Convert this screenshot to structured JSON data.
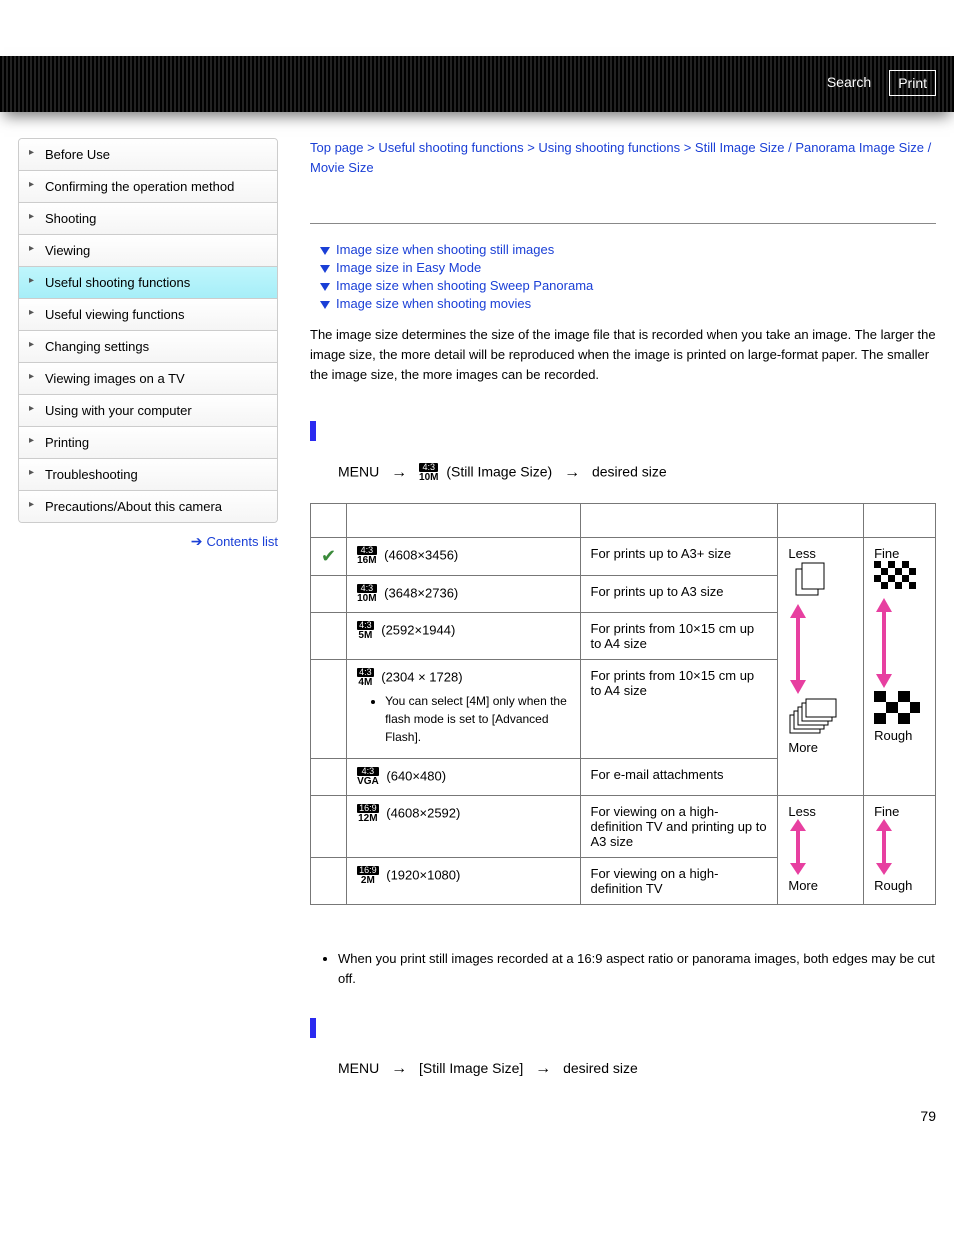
{
  "header": {
    "search": "Search",
    "print": "Print"
  },
  "sidebar": {
    "items": [
      "Before Use",
      "Confirming the operation method",
      "Shooting",
      "Viewing",
      "Useful shooting functions",
      "Useful viewing functions",
      "Changing settings",
      "Viewing images on a TV",
      "Using with your computer",
      "Printing",
      "Troubleshooting",
      "Precautions/About this camera"
    ],
    "active_index": 4,
    "contents_list": "Contents list"
  },
  "breadcrumb": {
    "items": [
      "Top page",
      "Useful shooting functions",
      "Using shooting functions",
      "Still Image Size / Panorama Image Size / Movie Size"
    ],
    "sep": " > "
  },
  "anchors": [
    "Image size when shooting still images",
    "Image size in Easy Mode",
    "Image size when shooting Sweep Panorama",
    "Image size when shooting movies"
  ],
  "intro": "The image size determines the size of the image file that is recorded when you take an image. The larger the image size, the more detail will be reproduced when the image is printed on large-format paper. The smaller the image size, the more images can be recorded.",
  "menu_path1": {
    "menu": "MENU",
    "badge_ratio": "4:3",
    "badge_mp": "10M",
    "label": "(Still Image Size)",
    "dest": "desired size"
  },
  "table": {
    "rows": [
      {
        "check": true,
        "ratio": "4:3",
        "mp": "16M",
        "dims": "(4608×3456)",
        "usage": "For prints up to A3+ size",
        "note": ""
      },
      {
        "check": false,
        "ratio": "4:3",
        "mp": "10M",
        "dims": "(3648×2736)",
        "usage": "For prints up to A3 size",
        "note": ""
      },
      {
        "check": false,
        "ratio": "4:3",
        "mp": "5M",
        "dims": "(2592×1944)",
        "usage": "For prints from 10×15 cm up to A4 size",
        "note": ""
      },
      {
        "check": false,
        "ratio": "4:3",
        "mp": "4M",
        "dims": "(2304 × 1728)",
        "usage": "For prints from 10×15 cm up to A4 size",
        "note": "You can select [4M] only when the flash mode is set to [Advanced Flash]."
      },
      {
        "check": false,
        "ratio": "4:3",
        "mp": "VGA",
        "dims": "(640×480)",
        "usage": "For e-mail attachments",
        "note": ""
      },
      {
        "check": false,
        "ratio": "16:9",
        "mp": "12M",
        "dims": "(4608×2592)",
        "usage": "For viewing on a high-definition TV and printing up to A3 size",
        "note": ""
      },
      {
        "check": false,
        "ratio": "16:9",
        "mp": "2M",
        "dims": "(1920×1080)",
        "usage": "For viewing on a high-definition TV",
        "note": ""
      }
    ],
    "scale_top": {
      "less": "Less",
      "fine": "Fine"
    },
    "scale_bottom": {
      "more": "More",
      "rough": "Rough"
    }
  },
  "notes": [
    "When you print still images recorded at a 16:9 aspect ratio or panorama images, both edges may be cut off."
  ],
  "menu_path2": {
    "menu": "MENU",
    "label": "[Still Image Size]",
    "dest": "desired size"
  },
  "page_number": "79"
}
